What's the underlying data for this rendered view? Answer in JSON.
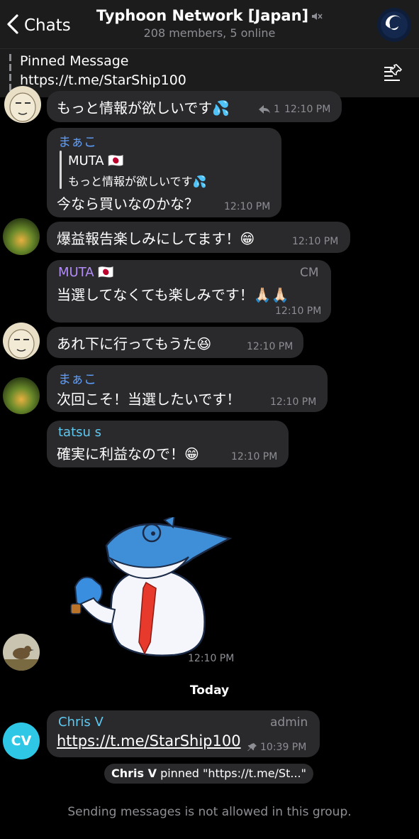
{
  "header": {
    "back_label": "Chats",
    "title": "Typhoon Network [Japan]",
    "subtitle": "208 members, 5 online"
  },
  "pinned": {
    "label": "Pinned Message",
    "text": "https://t.me/StarShip100"
  },
  "messages": [
    {
      "text": "もっと情報が欲しいです💦",
      "reply_count": "1",
      "time": "12:10 PM"
    },
    {
      "sender": "まぁこ",
      "quote_author": "MUTA 🇯🇵",
      "quote_text": "もっと情報が欲しいです💦",
      "text": "今なら買いなのかな？",
      "time": "12:10 PM"
    },
    {
      "text": "爆益報告楽しみにしてます！😁",
      "time": "12:10 PM"
    },
    {
      "sender": "MUTA 🇯🇵",
      "role": "CM",
      "text": "当選してなくても楽しみです！🙏🏻🙏🏻",
      "time": "12:10 PM"
    },
    {
      "text": "あれ下に行ってもうた😆",
      "time": "12:10 PM"
    },
    {
      "sender": "まぁこ",
      "text": "次回こそ！当選したいです！",
      "time": "12:10 PM"
    },
    {
      "sender": "tatsu s",
      "text": "確実に利益なので！😁",
      "time": "12:10 PM"
    },
    {
      "sticker": "shark-sticker",
      "time": "12:10 PM"
    }
  ],
  "today_label": "Today",
  "admin_message": {
    "sender": "Chris V",
    "role": "admin",
    "avatar_initials": "CV",
    "text": "https://t.me/StarShip100",
    "time": "10:39 PM"
  },
  "service": {
    "actor": "Chris V",
    "text": " pinned \"https://t.me/St...\""
  },
  "footer": "Sending messages is not allowed in this group.",
  "colors": {
    "background": "#000000",
    "bubble": "#2a2a2d",
    "header": "#1c1c1d",
    "sender_blue": "#5e9cf5",
    "sender_purple": "#b18cf5",
    "sender_cyan": "#5ec9f0",
    "admin_avatar": "#2ec7e6"
  }
}
